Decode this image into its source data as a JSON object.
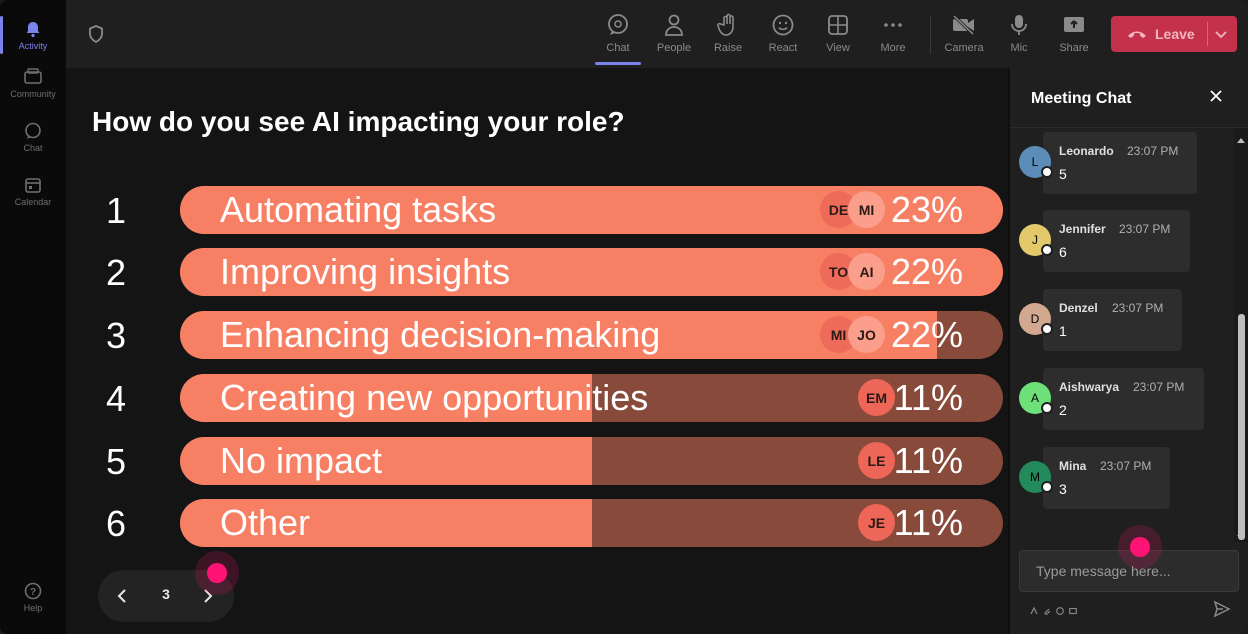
{
  "rail": {
    "items": [
      {
        "label": "Activity",
        "icon": "bell-icon"
      },
      {
        "label": "Community",
        "icon": "community-icon"
      },
      {
        "label": "Chat",
        "icon": "chat-icon"
      },
      {
        "label": "Calendar",
        "icon": "calendar-icon"
      }
    ],
    "help": {
      "label": "Help",
      "icon": "help-icon"
    }
  },
  "toolbar": {
    "buttons": [
      {
        "label": "Chat",
        "icon": "chat-icon"
      },
      {
        "label": "People",
        "icon": "people-icon"
      },
      {
        "label": "Raise",
        "icon": "raise-hand-icon"
      },
      {
        "label": "React",
        "icon": "react-icon"
      },
      {
        "label": "View",
        "icon": "view-icon"
      },
      {
        "label": "More",
        "icon": "more-icon"
      },
      {
        "label": "Camera",
        "icon": "camera-off-icon"
      },
      {
        "label": "Mic",
        "icon": "mic-icon"
      },
      {
        "label": "Share",
        "icon": "share-icon"
      }
    ],
    "leave_label": "Leave"
  },
  "poll": {
    "question": "How do you see AI impacting your role?",
    "options": [
      {
        "num": "1",
        "label": "Automating tasks",
        "percent_label": "23%",
        "fill": 1.0,
        "avatars": [
          "DE",
          "MI"
        ]
      },
      {
        "num": "2",
        "label": "Improving insights",
        "percent_label": "22%",
        "fill": 1.0,
        "avatars": [
          "TO",
          "AI"
        ]
      },
      {
        "num": "3",
        "label": "Enhancing decision-making",
        "percent_label": "22%",
        "fill": 0.92,
        "avatars": [
          "MI",
          "JO"
        ]
      },
      {
        "num": "4",
        "label": "Creating new opportunities",
        "percent_label": "11%",
        "fill": 0.5,
        "avatars": [
          "EM"
        ]
      },
      {
        "num": "5",
        "label": "No impact",
        "percent_label": "11%",
        "fill": 0.5,
        "avatars": [
          "LE"
        ]
      },
      {
        "num": "6",
        "label": "Other",
        "percent_label": "11%",
        "fill": 0.5,
        "avatars": [
          "JE"
        ]
      }
    ]
  },
  "pager": {
    "page": "3"
  },
  "chat": {
    "title": "Meeting Chat",
    "messages": [
      {
        "initial": "L",
        "name": "Leonardo",
        "time": "23:07 PM",
        "text": "5",
        "avatar_color": "#5b8db8"
      },
      {
        "initial": "J",
        "name": "Jennifer",
        "time": "23:07 PM",
        "text": "6",
        "avatar_color": "#e2c96a"
      },
      {
        "initial": "D",
        "name": "Denzel",
        "time": "23:07 PM",
        "text": "1",
        "avatar_color": "#d3a891"
      },
      {
        "initial": "A",
        "name": "Aishwarya",
        "time": "23:07 PM",
        "text": "2",
        "avatar_color": "#6ee07a"
      },
      {
        "initial": "M",
        "name": "Mina",
        "time": "23:07 PM",
        "text": "3",
        "avatar_color": "#238a5c"
      }
    ],
    "placeholder": "Type message here..."
  },
  "colors": {
    "bar_fill": "#f77f64",
    "bar_track": "#884a3b",
    "leave": "#c4314b",
    "accent": "#7b83eb",
    "cursor": "#ff1476"
  }
}
